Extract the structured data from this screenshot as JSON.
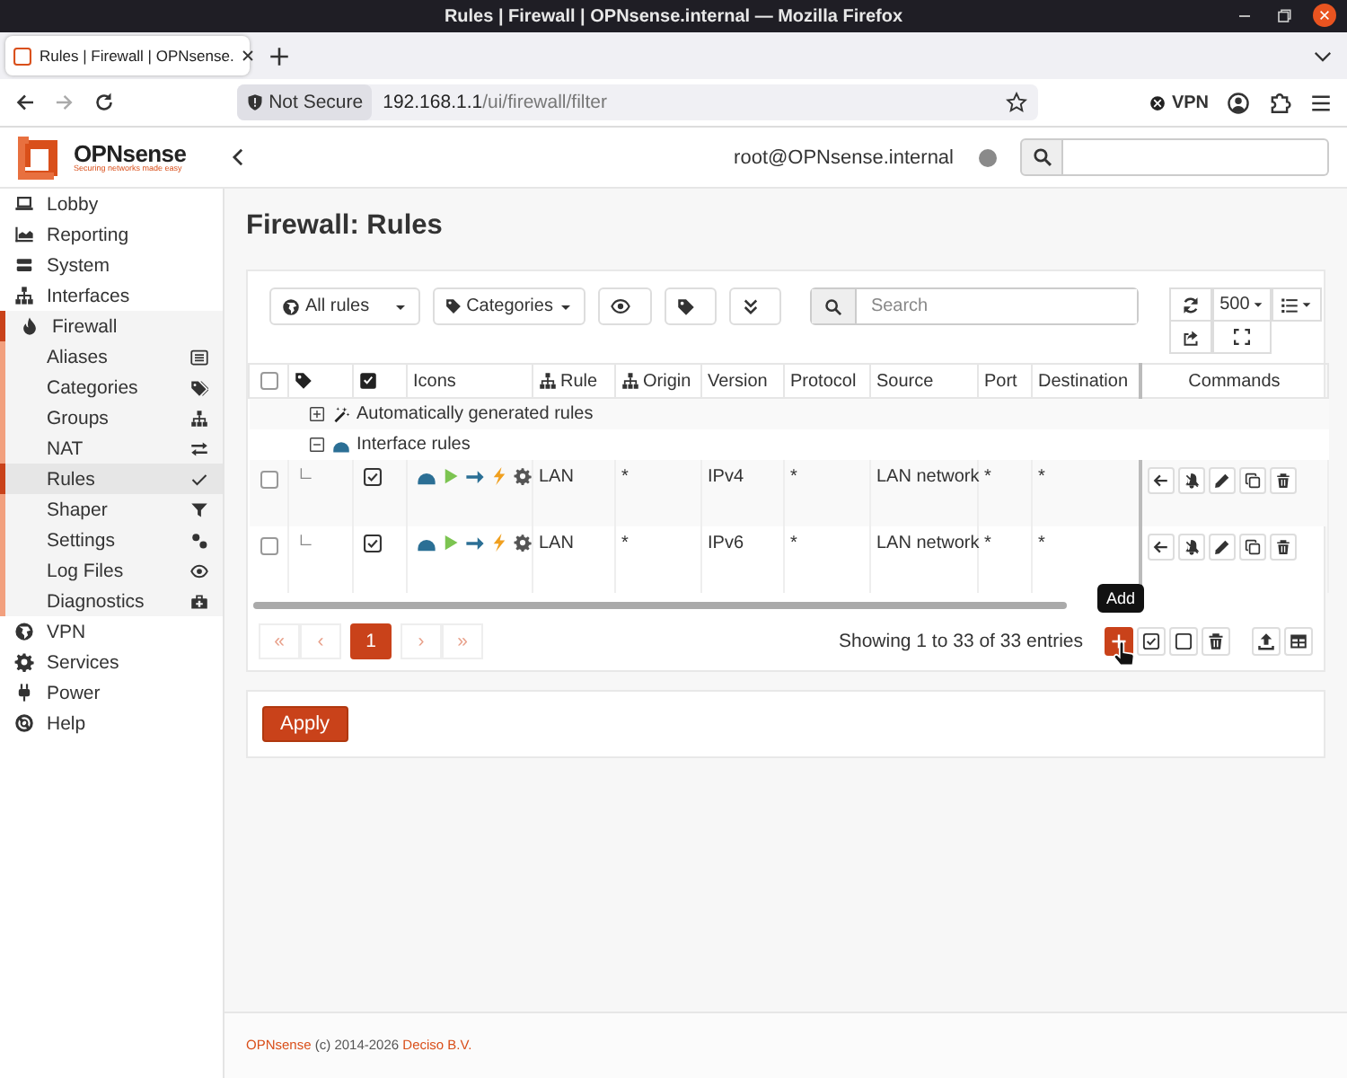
{
  "browser": {
    "window_title": "Rules | Firewall | OPNsense.internal — Mozilla Firefox",
    "tab_title": "Rules | Firewall | OPNsense.",
    "security": "Not Secure",
    "url_host": "192.168.1.1",
    "url_path": "/ui/firewall/filter",
    "vpn": "VPN"
  },
  "header": {
    "brand": "OPNsense",
    "tagline": "Securing networks made easy",
    "user": "root@OPNsense.internal"
  },
  "sidebar": {
    "items": [
      {
        "label": "Lobby",
        "expanded": false
      },
      {
        "label": "Reporting",
        "expanded": false
      },
      {
        "label": "System",
        "expanded": false
      },
      {
        "label": "Interfaces",
        "expanded": false
      },
      {
        "label": "Firewall",
        "expanded": true,
        "children": [
          {
            "label": "Aliases",
            "selected": false
          },
          {
            "label": "Categories",
            "selected": false
          },
          {
            "label": "Groups",
            "selected": false
          },
          {
            "label": "NAT",
            "selected": false
          },
          {
            "label": "Rules",
            "selected": true
          },
          {
            "label": "Shaper",
            "selected": false
          },
          {
            "label": "Settings",
            "selected": false
          },
          {
            "label": "Log Files",
            "selected": false
          },
          {
            "label": "Diagnostics",
            "selected": false
          }
        ]
      },
      {
        "label": "VPN",
        "expanded": false
      },
      {
        "label": "Services",
        "expanded": false
      },
      {
        "label": "Power",
        "expanded": false
      },
      {
        "label": "Help",
        "expanded": false
      }
    ]
  },
  "page": {
    "title": "Firewall: Rules"
  },
  "toolbar": {
    "filter": "All rules",
    "categories": "Categories",
    "search": {
      "placeholder": "Search"
    },
    "page_size": "500"
  },
  "table": {
    "select_all": false,
    "columns": [
      "Icons",
      "Rule",
      "Origin",
      "Version",
      "Protocol",
      "Source",
      "Port",
      "Destination",
      "Commands"
    ],
    "groups": [
      {
        "label": "Automatically generated rules",
        "expanded": false
      },
      {
        "label": "Interface rules",
        "expanded": true,
        "rows": [
          {
            "selected": false,
            "enabled": true,
            "rule": "LAN",
            "origin": "*",
            "version": "IPv4",
            "protocol": "*",
            "source": "LAN network",
            "port": "*",
            "destination": "*"
          },
          {
            "selected": false,
            "enabled": true,
            "rule": "LAN",
            "origin": "*",
            "version": "IPv6",
            "protocol": "*",
            "source": "LAN network",
            "port": "*",
            "destination": "*"
          }
        ]
      }
    ]
  },
  "pagination": {
    "pages": [
      {
        "label": "«",
        "selected": false,
        "disabled": true
      },
      {
        "label": "‹",
        "selected": false,
        "disabled": true
      },
      {
        "label": "1",
        "selected": true,
        "disabled": false
      },
      {
        "label": "›",
        "selected": false,
        "disabled": true
      },
      {
        "label": "»",
        "selected": false,
        "disabled": true
      }
    ],
    "info": "Showing 1 to 33 of 33 entries",
    "tooltip": "Add"
  },
  "apply": "Apply",
  "footer": {
    "brand": "OPNsense",
    "copyright": "(c) 2014-2026",
    "company": "Deciso B.V."
  }
}
